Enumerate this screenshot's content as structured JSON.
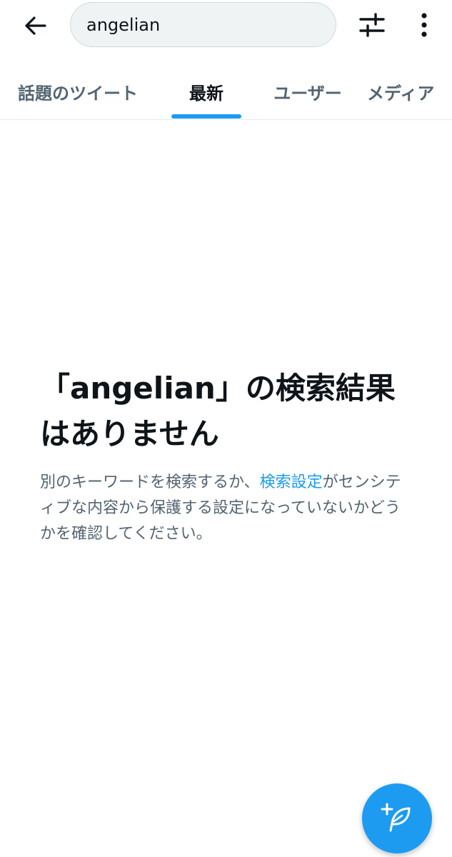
{
  "search": {
    "query": "angelian"
  },
  "tabs": [
    {
      "label": "話題のツイート"
    },
    {
      "label": "最新",
      "active": true
    },
    {
      "label": "ユーザー"
    },
    {
      "label": "メディア"
    }
  ],
  "empty_state": {
    "title": "「angelian」の検索結果はありません",
    "desc_before": "別のキーワードを検索するか、",
    "desc_link": "検索設定",
    "desc_after": "がセンシティブな内容から保護する設定になっていないかどうかを確認してください。"
  },
  "icons": {
    "back": "arrow-left-icon",
    "filter": "sliders-icon",
    "more": "more-vertical-icon",
    "compose": "feather-plus-icon"
  },
  "colors": {
    "accent": "#1d9bf0",
    "text_primary": "#0f1419",
    "text_secondary": "#536471"
  }
}
